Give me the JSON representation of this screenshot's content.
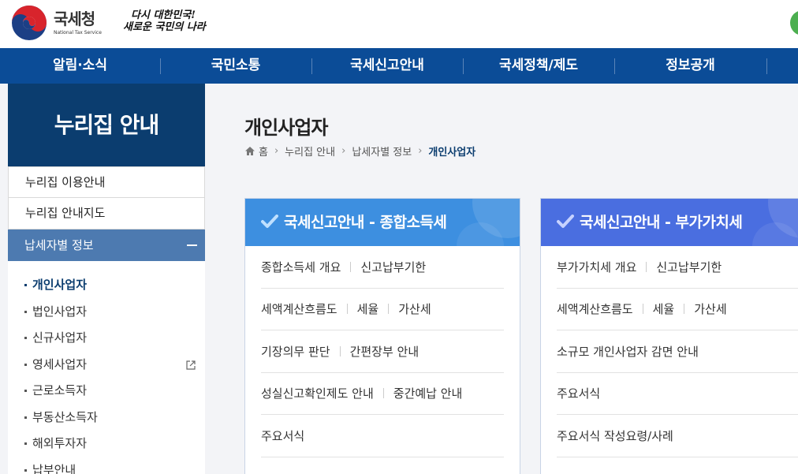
{
  "header": {
    "logo_kr": "국세청",
    "logo_en": "National Tax Service",
    "slogan_line1": "다시 대한민국!",
    "slogan_line2": "새로운 국민의 나라"
  },
  "gnb": [
    "알림·소식",
    "국민소통",
    "국세신고안내",
    "국세정책/제도",
    "정보공개"
  ],
  "sidebar": {
    "title": "누리집 안내",
    "items": [
      "누리집 이용안내",
      "누리집 안내지도"
    ],
    "active_section": "납세자별 정보",
    "sub_items": [
      "개인사업자",
      "법인사업자",
      "신규사업자",
      "영세사업자",
      "근로소득자",
      "부동산소득자",
      "해외투자자",
      "납부안내"
    ]
  },
  "main": {
    "title": "개인사업자",
    "breadcrumb": [
      "홈",
      "누리집 안내",
      "납세자별 정보",
      "개인사업자"
    ]
  },
  "cards": [
    {
      "title": "국세신고안내 - 종합소득세",
      "rows": [
        [
          "종합소득세 개요",
          "신고납부기한"
        ],
        [
          "세액계산흐름도",
          "세율",
          "가산세"
        ],
        [
          "기장의무 판단",
          "간편장부 안내"
        ],
        [
          "성실신고확인제도 안내",
          "중간예납 안내"
        ],
        [
          "주요서식"
        ]
      ]
    },
    {
      "title": "국세신고안내 - 부가가치세",
      "rows": [
        [
          "부가가치세 개요",
          "신고납부기한"
        ],
        [
          "세액계산흐름도",
          "세율",
          "가산세"
        ],
        [
          "소규모 개인사업자 감면 안내"
        ],
        [
          "주요서식"
        ],
        [
          "주요서식 작성요령/사례"
        ]
      ]
    }
  ],
  "colors": {
    "nav": "#0b4c97",
    "sidebar_title": "#0b3d6f",
    "sidebar_active": "#4d7ab0",
    "card1_head": "#3d8fe0",
    "card2_head": "#4a6ee0"
  }
}
